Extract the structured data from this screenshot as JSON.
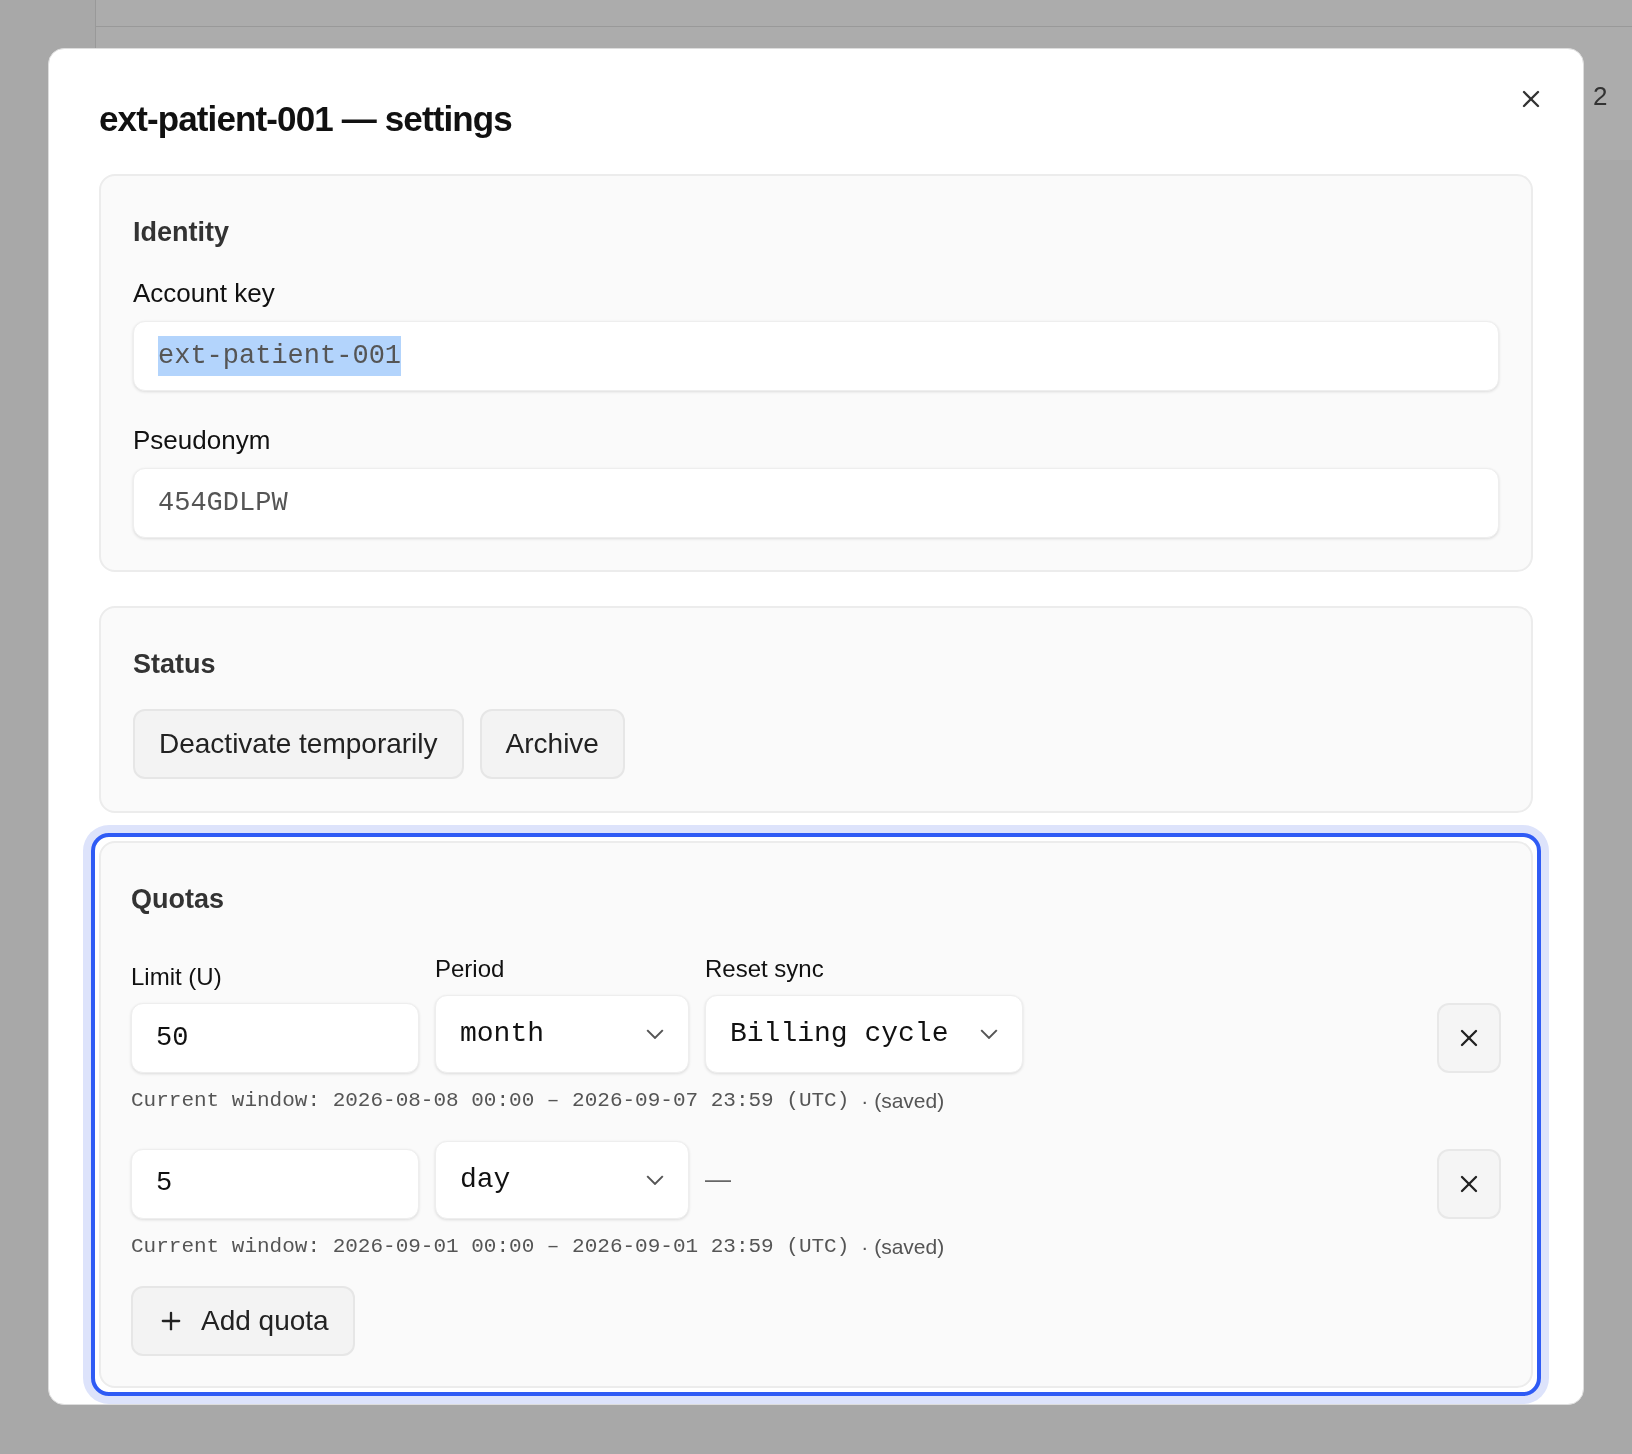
{
  "background": {
    "page_text": "2"
  },
  "dialog": {
    "title": "ext-patient-001 — settings"
  },
  "identity": {
    "heading": "Identity",
    "fields": [
      {
        "label": "Account key",
        "value": "ext-patient-001",
        "text_selected": true
      },
      {
        "label": "Pseudonym",
        "value": "454GDLPW",
        "text_selected": false
      }
    ]
  },
  "status": {
    "heading": "Status",
    "buttons": [
      "Deactivate temporarily",
      "Archive"
    ]
  },
  "quotas": {
    "heading": "Quotas",
    "focused": true,
    "columns": [
      "Limit (U)",
      "Period",
      "Reset sync"
    ],
    "rows": [
      {
        "limit": "50",
        "period": "month",
        "reset": {
          "kind": "select",
          "value": "Billing cycle"
        },
        "window": "Current window: 2026-08-08 00:00 – 2026-09-07 23:59 (UTC)",
        "saved": "· (saved)"
      },
      {
        "limit": "5",
        "period": "day",
        "reset": {
          "kind": "none",
          "value": "—"
        },
        "window": "Current window: 2026-09-01 00:00 – 2026-09-01 23:59 (UTC)",
        "saved": "· (saved)"
      }
    ],
    "add_button": "Add quota"
  }
}
